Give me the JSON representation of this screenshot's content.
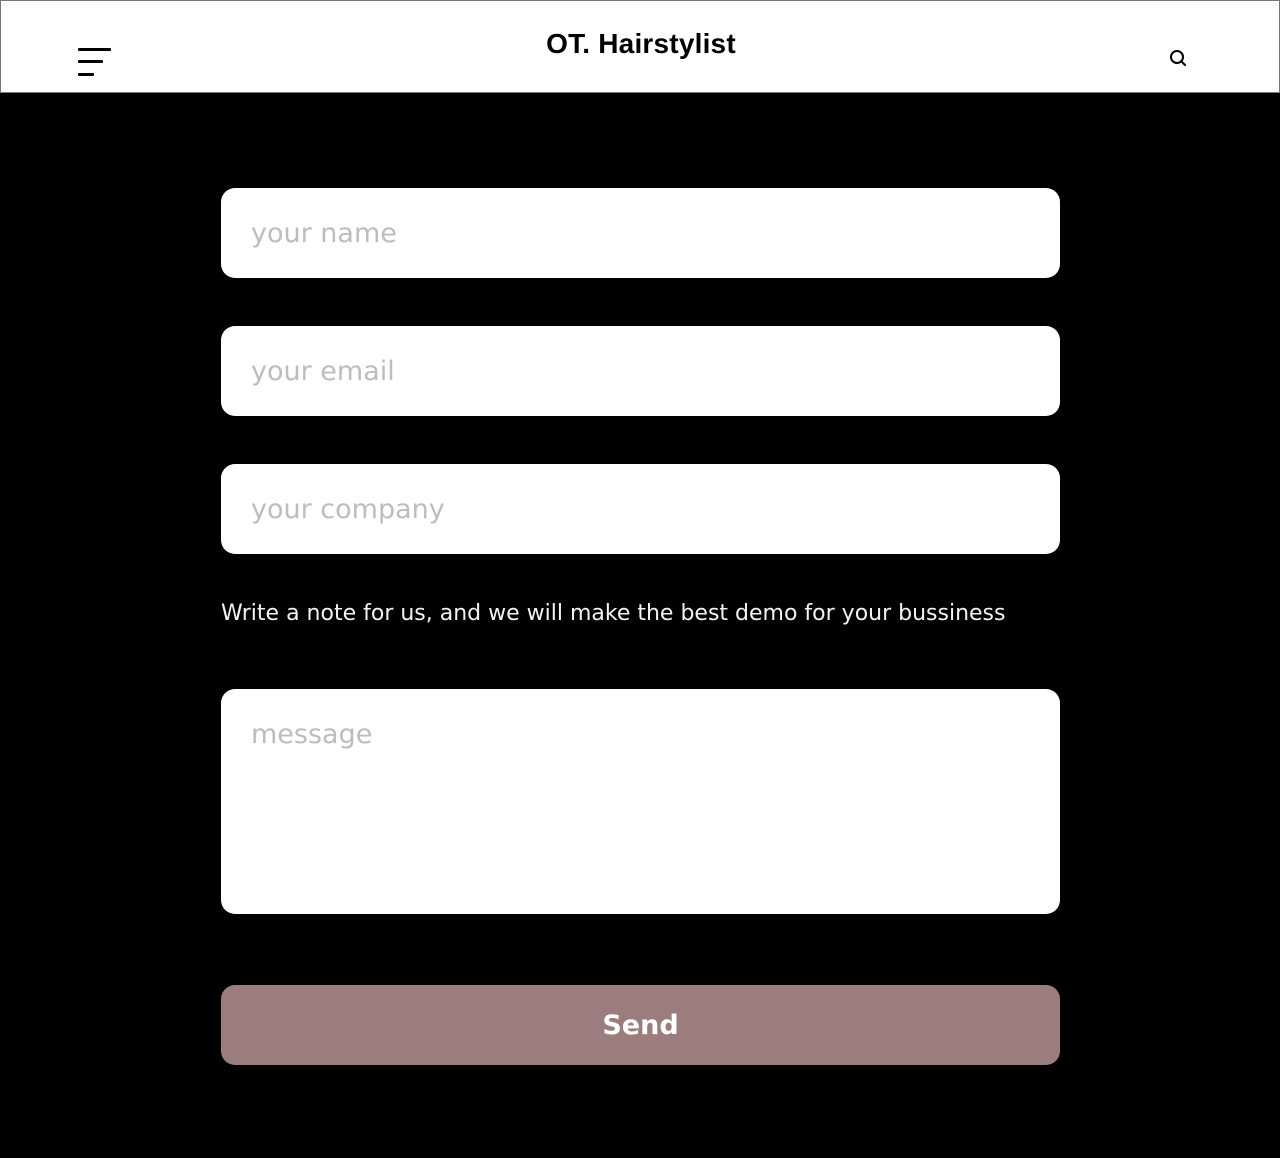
{
  "header": {
    "title": "OT. Hairstylist",
    "menu_icon": "hamburger-menu-icon",
    "search_icon": "search-icon"
  },
  "form": {
    "name_placeholder": "your name",
    "email_placeholder": "your email",
    "company_placeholder": "your company",
    "note": "Write a note for us, and we will make the best demo for your bussiness",
    "message_placeholder": "message",
    "send_label": "Send"
  },
  "colors": {
    "background": "#000000",
    "header_background": "#ffffff",
    "button_background": "#9c7d7d",
    "placeholder": "#bdbdbd"
  }
}
